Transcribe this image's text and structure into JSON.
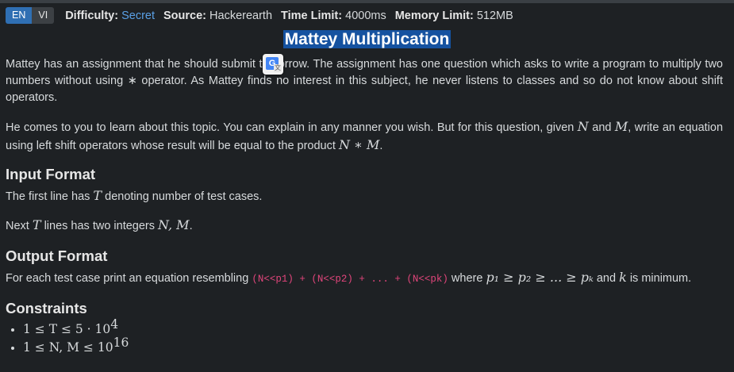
{
  "lang_tabs": [
    "EN",
    "VI"
  ],
  "meta": {
    "difficulty_label": "Difficulty:",
    "difficulty_value": "Secret",
    "source_label": "Source:",
    "source_value": "Hackerearth",
    "time_label": "Time Limit:",
    "time_value": "4000ms",
    "memory_label": "Memory Limit:",
    "memory_value": "512MB"
  },
  "title": "Mattey Multiplication",
  "translate_icon": "G",
  "statement": {
    "p1": "Mattey has an assignment that he should submit tomorrow. The assignment has one question which asks to write a program to multiply two numbers without using ∗ operator. As Mattey finds no interest in this subject, he never listens to classes and so do not know about shift operators.",
    "p2a": "He comes to you to learn about this topic. You can explain in any manner you wish. But for this question, given",
    "p2_and": "and",
    "p2b": ", write an equation using left shift operators whose result will be equal to the product",
    "N": "N",
    "M": "M",
    "NM": "N ∗ M",
    "period": "."
  },
  "input": {
    "heading": "Input Format",
    "l1a": "The first line has",
    "T": "T",
    "l1b": "denoting number of test cases.",
    "l2a": "Next",
    "l2b": "lines has two integers",
    "NM": "N, M",
    "period": "."
  },
  "output": {
    "heading": "Output Format",
    "a": "For each test case print an equation resembling",
    "code": "(N<<p1) + (N<<p2) + ... + (N<<pk)",
    "where": "where",
    "pcond": "p₁ ≥ p₂ ≥ ... ≥ pₖ",
    "and": "and",
    "k": "k",
    "min": "is minimum."
  },
  "constraints": {
    "heading": "Constraints",
    "c1": "1 ≤ T ≤ 5 · 10",
    "c1exp": "4",
    "c2": "1 ≤ N, M ≤ 10",
    "c2exp": "16"
  }
}
